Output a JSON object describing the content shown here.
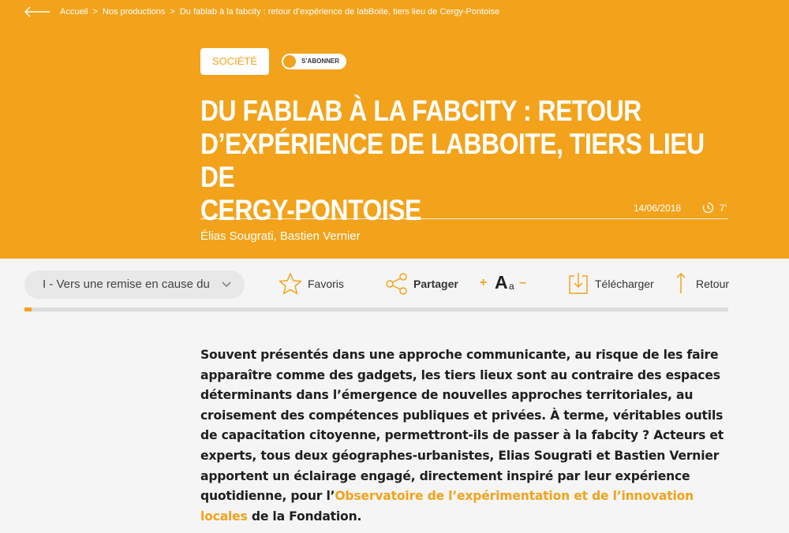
{
  "breadcrumb": {
    "items": [
      "Accueil",
      "Nos productions",
      "Du fablab à la fabcity : retour d’expérience de labBoite, tiers lieu de Cergy-Pontoise"
    ],
    "separator": ">"
  },
  "article": {
    "tag": "SOCIÉTÉ",
    "subscribe_label": "S’ABONNER",
    "title_lines": [
      "DU FABLAB À LA FABCITY : RETOUR",
      "D’EXPÉRIENCE DE LABBOITE, TIERS LIEU DE",
      "CERGY-PONTOISE"
    ],
    "date": "14/06/2018",
    "reading_time": "7’",
    "authors": "Élias Sougrati, Bastien Vernier"
  },
  "toolbar": {
    "toc_selected": "I - Vers une remise en cause du",
    "favorites_label": "Favoris",
    "share_label": "Partager",
    "font_increase": "+",
    "font_sample_big": "A",
    "font_sample_small": "a",
    "font_decrease": "–",
    "download_label": "Télécharger",
    "return_label": "Retour"
  },
  "reading_progress": 0.01,
  "body": {
    "intro_before_link": "Souvent présentés dans une approche communicante, au risque de les faire apparaître comme des gadgets, les tiers lieux sont au contraire des espaces déterminants dans l’émergence de nouvelles approches territoriales, au croisement des compétences publiques et privées. À terme, véritables outils de capacitation citoyenne, permettront-ils de passer à la fabcity ? Acteurs et experts, tous deux géographes-urbanistes, Elias Sougrati et Bastien Vernier apportent un éclairage engagé, directement inspiré par leur expérience quotidienne, pour l’",
    "intro_link": "Observatoire de l’expérimentation et de l’innovation locales",
    "intro_after_link": " de la Fondation."
  },
  "colors": {
    "accent": "#f2a31b",
    "background": "#f5f5f5",
    "text": "#1e1e1e"
  },
  "icons": [
    "back-arrow-icon",
    "clock-icon",
    "chevron-down-icon",
    "star-icon",
    "share-icon",
    "download-icon",
    "arrow-up-icon"
  ]
}
